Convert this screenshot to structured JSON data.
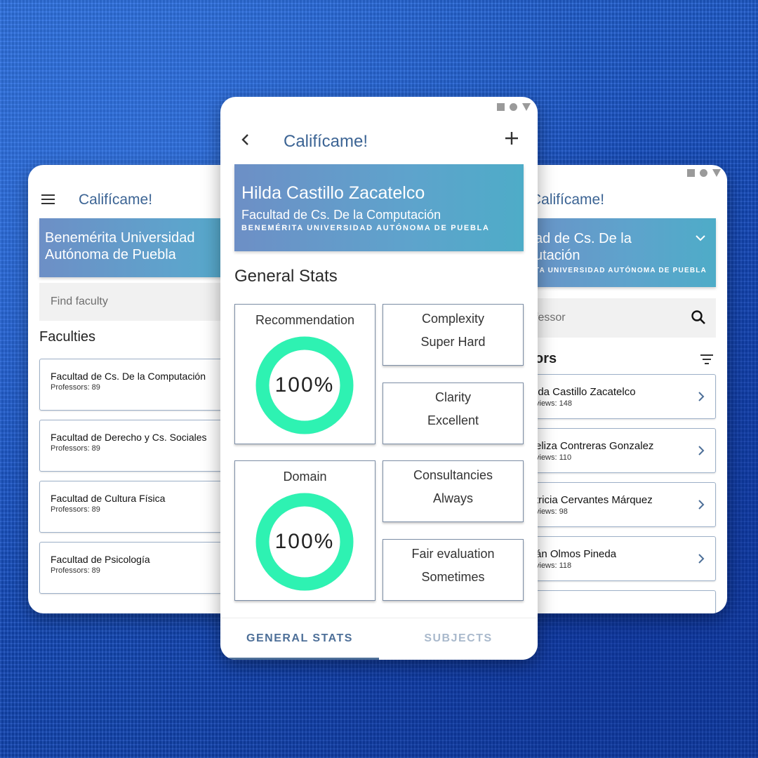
{
  "app": {
    "title": "Califícame!"
  },
  "left": {
    "banner": {
      "line1": "Benemérita Universidad",
      "line2": "Autónoma de Puebla"
    },
    "search": {
      "placeholder": "Find faculty"
    },
    "heading": "Faculties",
    "faculties": [
      {
        "name": "Facultad de Cs. De la Computación",
        "sub": "Professors: 89"
      },
      {
        "name": "Facultad de Derecho y Cs. Sociales",
        "sub": "Professors: 89"
      },
      {
        "name": "Facultad de Cultura Física",
        "sub": "Professors: 89"
      },
      {
        "name": "Facultad de Psicología",
        "sub": "Professors: 89"
      }
    ]
  },
  "center": {
    "banner": {
      "professor": "Hilda Castillo Zacatelco",
      "faculty": "Facultad de Cs. De la Computación",
      "university": "BENEMÉRITA UNIVERSIDAD AUTÓNOMA DE PUEBLA"
    },
    "section_title": "General Stats",
    "stats": {
      "recommendation": {
        "label": "Recommendation",
        "value": "100%",
        "fraction": 1.0
      },
      "complexity": {
        "label": "Complexity",
        "value": "Super Hard"
      },
      "clarity": {
        "label": "Clarity",
        "value": "Excellent"
      },
      "domain": {
        "label": "Domain",
        "value": "100%",
        "fraction": 1.0
      },
      "consultancies": {
        "label": "Consultancies",
        "value": "Always"
      },
      "fair": {
        "label": "Fair evaluation",
        "value": "Sometimes"
      }
    },
    "tabs": {
      "general": "GENERAL STATS",
      "subjects": "SUBJECTS"
    }
  },
  "right": {
    "banner": {
      "line1": "ad de Cs. De la",
      "line2": "utación",
      "line3": "TA UNIVERSIDAD AUTÓNOMA DE PUEBLA"
    },
    "search": {
      "placeholder": "fessor"
    },
    "heading": "ors",
    "professors": [
      {
        "name": "lda Castillo Zacatelco",
        "reviews": "views: 148"
      },
      {
        "name": "eliza Contreras Gonzalez",
        "reviews": "views: 110"
      },
      {
        "name": "tricia Cervantes Márquez",
        "reviews": "views: 98"
      },
      {
        "name": "án Olmos Pineda",
        "reviews": "views: 118"
      }
    ]
  },
  "colors": {
    "ring": "#2ef2b2",
    "accent": "#3c6494",
    "banner_start": "#6d8fc6",
    "banner_end": "#4eacc8"
  }
}
